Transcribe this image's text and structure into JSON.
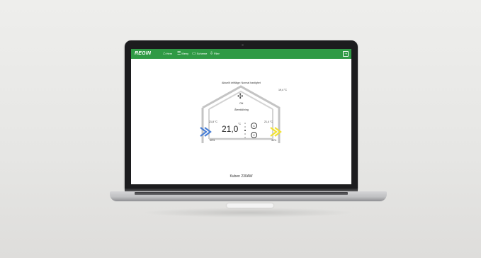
{
  "app": {
    "brand": "REGIN",
    "nav": [
      {
        "icon": "home-icon",
        "glyph": "⌂",
        "label": "Hem"
      },
      {
        "icon": "menu-icon",
        "glyph": "☰",
        "label": "Meny"
      },
      {
        "icon": "calendar-icon",
        "glyph": "▭",
        "label": "Scheme"
      },
      {
        "icon": "download-icon",
        "glyph": "⇩",
        "label": "Filer"
      }
    ],
    "exit_glyph": "⇥"
  },
  "house": {
    "status_title": "Aktuellt driftläge: Normal hastighet",
    "outdoor_temp": "19,4 °C",
    "fan_state": "ON",
    "fan_mode": "Återställning",
    "left_temp": "21,8 °C",
    "right_temp": "21,4 °C",
    "setpoint": "21,0",
    "setpoint_unit": "°C",
    "left_humidity": "40%",
    "right_humidity": "40%",
    "up_glyph": "∧",
    "down_glyph": "∨",
    "colors": {
      "supply_arrow": "#4a7fd4",
      "exhaust_arrow": "#f2e234",
      "house_outline": "#c4c4c4",
      "topbar": "#2f9a45"
    }
  },
  "device": {
    "model": "Kuben 230AW"
  }
}
